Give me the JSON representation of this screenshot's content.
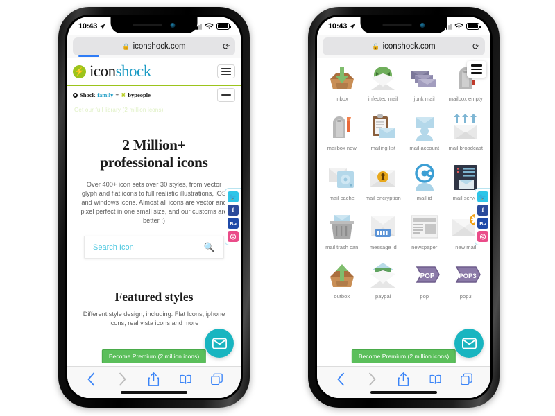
{
  "status_bar": {
    "time": "10:43",
    "location_icon": "location-arrow-icon",
    "wifi_icon": "wifi-icon",
    "battery_icon": "battery-icon"
  },
  "browser": {
    "url": "iconshock.com",
    "lock_icon": "lock-icon",
    "reload_icon": "reload-icon",
    "tabs": [
      {
        "name": "back-button",
        "icon": "chevron-left-icon",
        "enabled": false
      },
      {
        "name": "forward-button",
        "icon": "chevron-right-icon",
        "enabled": false
      },
      {
        "name": "share-button",
        "icon": "share-up-icon",
        "enabled": true
      },
      {
        "name": "bookmarks-button",
        "icon": "book-icon",
        "enabled": true
      },
      {
        "name": "tabs-button",
        "icon": "copy-squares-icon",
        "enabled": true
      }
    ]
  },
  "phone_left": {
    "header": {
      "logo_mark_icon": "lightning-bolt-icon",
      "logo_primary": "icon",
      "logo_secondary": "shock",
      "menu_icon": "hamburger-icon"
    },
    "family_bar": {
      "brand_dot_icon": "circle-dot-icon",
      "part1": "Shock",
      "part2": "family",
      "plus": "+",
      "x_icon": "x-mark-icon",
      "part3": "bypeople",
      "menu_icon": "hamburger-icon"
    },
    "faded_text": "Get our full library (2 million icons)",
    "hero": {
      "title_line1": "2 Million+",
      "title_line2": "professional icons",
      "paragraph": "Over 400+ icon sets over 30 styles, from vector glyph and flat icons to full realistic illustrations, iOS and windows icons. Almost all icons are vector and pixel perfect in one small size, and our customs are better :)"
    },
    "search": {
      "placeholder": "Search Icon",
      "value": "",
      "icon": "magnifier-icon"
    },
    "featured": {
      "title": "Featured styles",
      "paragraph": "Different style design, including: Flat Icons, iphone icons, real vista icons and more"
    },
    "premium_button": "Become Premium (2 million icons)",
    "chat_icon": "envelope-icon"
  },
  "phone_right": {
    "menu_icon": "hamburger-icon",
    "premium_button": "Become Premium (2 million icons)",
    "chat_icon": "envelope-icon",
    "icons": [
      {
        "label": "inbox",
        "icon": "inbox-tray-down-icon"
      },
      {
        "label": "infected mail",
        "icon": "infected-mail-monster-icon"
      },
      {
        "label": "junk mail",
        "icon": "junk-mail-stack-icon"
      },
      {
        "label": "mailbox empty",
        "icon": "mailbox-empty-icon"
      },
      {
        "label": "mailbox new",
        "icon": "mailbox-new-flag-icon"
      },
      {
        "label": "mailing list",
        "icon": "mailing-list-clipboard-icon"
      },
      {
        "label": "mail account",
        "icon": "mail-account-user-icon"
      },
      {
        "label": "mail broadcast",
        "icon": "mail-broadcast-arrows-icon"
      },
      {
        "label": "mail cache",
        "icon": "mail-cache-disk-icon"
      },
      {
        "label": "mail encryption",
        "icon": "mail-encryption-lock-icon"
      },
      {
        "label": "mail id",
        "icon": "mail-id-at-user-icon"
      },
      {
        "label": "mail server",
        "icon": "mail-server-rack-icon"
      },
      {
        "label": "mail trash can",
        "icon": "mail-trash-can-icon"
      },
      {
        "label": "message id",
        "icon": "message-id-barcode-icon"
      },
      {
        "label": "newspaper",
        "icon": "newspaper-icon"
      },
      {
        "label": "new mail",
        "icon": "new-mail-star-icon"
      },
      {
        "label": "outbox",
        "icon": "outbox-tray-up-icon"
      },
      {
        "label": "paypal",
        "icon": "paypal-money-mail-icon"
      },
      {
        "label": "pop",
        "icon": "pop-arrow-icon",
        "badge": "POP"
      },
      {
        "label": "pop3",
        "icon": "pop3-arrow-icon",
        "badge": "POP3"
      }
    ]
  },
  "social_rail": [
    {
      "name": "twitter",
      "glyph": "t",
      "color": "#2ec5e8"
    },
    {
      "name": "facebook",
      "glyph": "f",
      "color": "#2b4a9b"
    },
    {
      "name": "behance",
      "glyph": "Be",
      "color": "#1f4aa8"
    },
    {
      "name": "dribbble",
      "glyph": "d",
      "color": "#ea4c89"
    }
  ],
  "colors": {
    "brand_green": "#9cc41c",
    "brand_blue": "#1b9bc4",
    "accent_cyan": "#19b5c0",
    "premium_green": "#5bbf5b",
    "search_text": "#4ec8e0"
  }
}
